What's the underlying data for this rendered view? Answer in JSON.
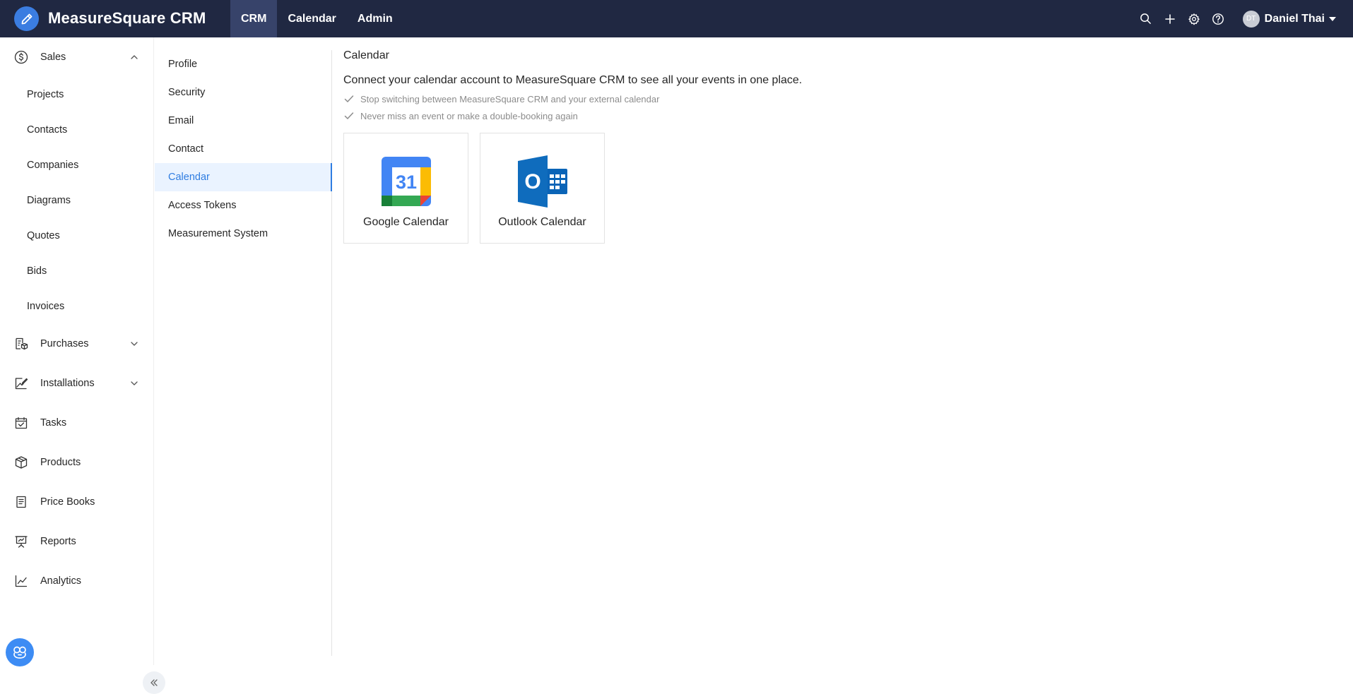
{
  "app": {
    "name": "MeasureSquare CRM"
  },
  "top_nav": {
    "tabs": [
      {
        "label": "CRM",
        "active": true
      },
      {
        "label": "Calendar",
        "active": false
      },
      {
        "label": "Admin",
        "active": false
      }
    ]
  },
  "top_actions": {
    "icons": [
      "search-icon",
      "plus-icon",
      "gear-icon",
      "help-icon"
    ],
    "user": {
      "initials": "DT",
      "name": "Daniel Thai"
    }
  },
  "sidebar": {
    "sales": {
      "label": "Sales",
      "icon": "dollar-icon",
      "expanded": true
    },
    "sales_items": [
      "Projects",
      "Contacts",
      "Companies",
      "Diagrams",
      "Quotes",
      "Bids",
      "Invoices"
    ],
    "purchases": {
      "label": "Purchases",
      "icon": "purchases-icon"
    },
    "installations": {
      "label": "Installations",
      "icon": "installations-icon"
    },
    "tasks": {
      "label": "Tasks",
      "icon": "tasks-icon"
    },
    "products": {
      "label": "Products",
      "icon": "box-icon"
    },
    "price_books": {
      "label": "Price Books",
      "icon": "book-icon"
    },
    "reports": {
      "label": "Reports",
      "icon": "presentation-icon"
    },
    "analytics": {
      "label": "Analytics",
      "icon": "chart-icon"
    }
  },
  "settings_menu": {
    "items": [
      "Profile",
      "Security",
      "Email",
      "Contact",
      "Calendar",
      "Access Tokens",
      "Measurement System"
    ],
    "active": "Calendar"
  },
  "main": {
    "title": "Calendar",
    "intro": "Connect your calendar account to MeasureSquare CRM to see all your events in one place.",
    "checks": [
      "Stop switching between MeasureSquare CRM and your external calendar",
      "Never miss an event or make a double-booking again"
    ],
    "providers": [
      {
        "label": "Google Calendar",
        "icon": "google-calendar-icon",
        "day": "31"
      },
      {
        "label": "Outlook Calendar",
        "icon": "outlook-icon",
        "letter": "O"
      }
    ]
  },
  "colors": {
    "topbar": "#202842",
    "topbar_active": "#37436a",
    "accent": "#2f7de1",
    "active_bg": "#eaf3ff",
    "bot_button": "#3d8cf4"
  }
}
